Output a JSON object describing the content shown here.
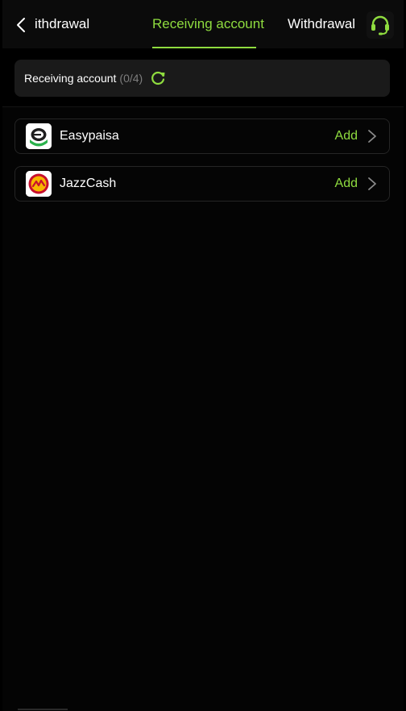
{
  "header": {
    "tabs": [
      {
        "label": "Fast withdrawal",
        "active": false
      },
      {
        "label": "Receiving account",
        "active": true
      },
      {
        "label": "Withdrawal history",
        "active": false
      }
    ],
    "back_icon": "chevron-left-icon",
    "support_icon": "headset-icon"
  },
  "summary": {
    "label": "Receiving account",
    "count": "(0/4)",
    "refresh_icon": "refresh-icon"
  },
  "accounts": [
    {
      "name": "Easypaisa",
      "action": "Add",
      "logo_icon": "easypaisa-logo-icon"
    },
    {
      "name": "JazzCash",
      "action": "Add",
      "logo_icon": "jazzcash-logo-icon"
    }
  ],
  "colors": {
    "accent": "#8fdc3f",
    "background": "#000000",
    "row_border": "#252525",
    "muted": "#7d7d7d"
  }
}
